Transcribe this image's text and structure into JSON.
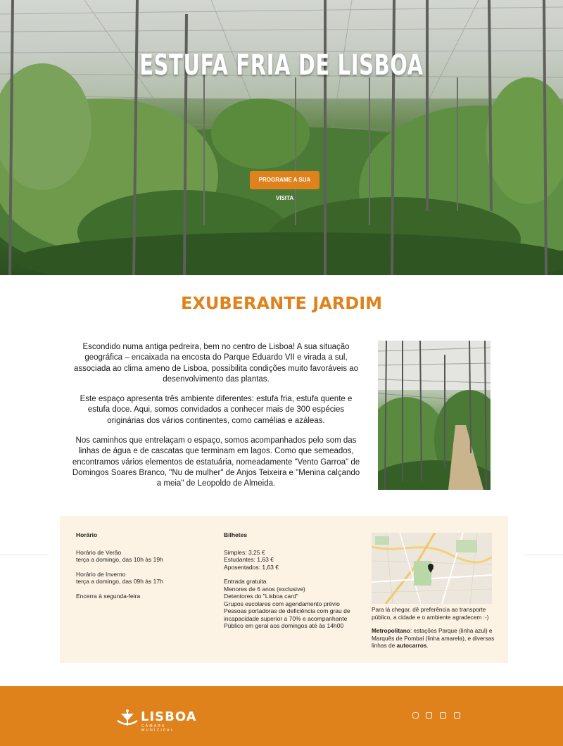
{
  "hero": {
    "title": "ESTUFA FRIA DE LISBOA",
    "cta_label": "PROGRAME A SUA VISITA"
  },
  "section": {
    "title": "EXUBERANTE JARDIM",
    "paragraphs": [
      "Escondido numa antiga pedreira, bem no centro de Lisboa! A sua situação geográfica – encaixada na encosta do Parque Eduardo VII e virada a sul, associada ao clima ameno de Lisboa, possibilita condições muito favoráveis ao desenvolvimento das plantas.",
      "Este espaço apresenta três ambiente diferentes: estufa fria, estufa quente e estufa doce. Aqui, somos convidados a conhecer mais de 300 espécies originárias dos vários continentes, como camélias e azáleas.",
      "Nos caminhos que entrelaçam o espaço, somos acompanhados pelo som das linhas de água e de cascatas que terminam em lagos. Como que semeados, encontramos vários elementos de estatuária, nomeadamente \"Vento Garroa\" de Domingos Soares Branco, \"Nu de mulher\" de Anjos Teixeira e \"Menina calçando a meia\" de Leopoldo de Almeida."
    ]
  },
  "info": {
    "horario": {
      "heading": "Horário",
      "verao_label": "Horário de Verão",
      "verao_hours": "terça a domingo, das 10h às 19h",
      "inverno_label": "Horário de Inverno",
      "inverno_hours": "terça a domingo, das 09h às 17h",
      "closed": "Encerra à segunda-feira"
    },
    "bilhetes": {
      "heading": "Bilhetes",
      "prices": [
        "Simples: 3,25 €",
        "Estudantes: 1,63 €",
        "Aposentados: 1,63 €"
      ],
      "free_heading": "Entrada gratuita",
      "free_items": [
        "Menores de 6 anos (exclusive)",
        "Detentores do \"Lisboa card\"",
        "Grupos escolares com agendamento prévio",
        "Pessoas portadoras de deficiência com grau de incapacidade superior a 70% e acompanhante",
        "Público em geral aos domingos até às 14h00"
      ]
    },
    "transport": {
      "intro": "Para lá chegar, dê preferência ao transporte público, a cidade e o ambiente agradecem :-)",
      "metro_label": "Metropolitano",
      "metro_text": ": estações Parque (linha azul) e Marquês de Pombal (linha amarela), e diversas linhas de ",
      "bus_label": "autocarros",
      "end": "."
    }
  },
  "footer": {
    "logo_text": "LISBOA",
    "logo_sub": "CÂMARA MUNICIPAL",
    "social_icons": [
      "instagram-icon",
      "flickr-icon",
      "linkedin-icon",
      "youtube-icon"
    ]
  },
  "colors": {
    "accent": "#e0821c",
    "info_bg": "#fdf3e4"
  }
}
